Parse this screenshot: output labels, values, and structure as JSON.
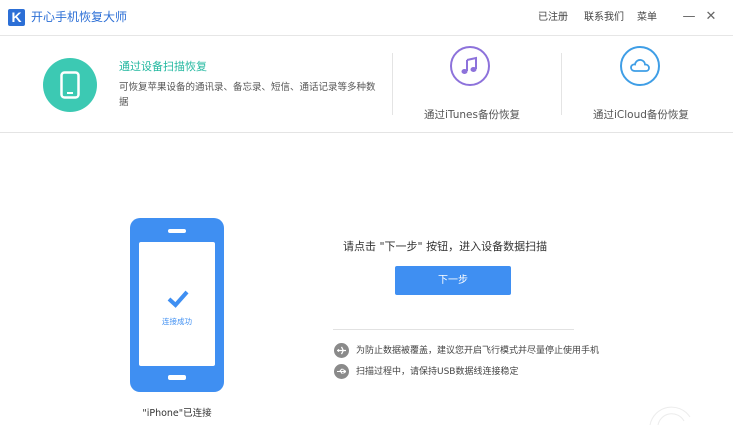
{
  "app": {
    "logo_letter": "K",
    "title": "开心手机恢复大师"
  },
  "titlebar": {
    "registered": "已注册",
    "contact": "联系我们",
    "menu": "菜单",
    "minimize": "—",
    "close": "✕"
  },
  "modes": [
    {
      "title": "通过设备扫描恢复",
      "description": "可恢复苹果设备的通讯录、备忘录、短信、通话记录等多种数据",
      "icon": "phone-icon",
      "color": "#3cc9b3",
      "active": true
    },
    {
      "title": "通过iTunes备份恢复",
      "icon": "music-note-icon",
      "color": "#8d72db"
    },
    {
      "title": "通过iCloud备份恢复",
      "icon": "cloud-icon",
      "color": "#3f9ee6"
    }
  ],
  "device": {
    "status": "连接成功",
    "label": "\"iPhone\"已连接"
  },
  "main": {
    "prompt": "请点击 \"下一步\" 按钮，进入设备数据扫描",
    "next_button": "下一步",
    "accent": "#3f8ff2"
  },
  "tips": [
    {
      "icon": "airplane-icon",
      "text": "为防止数据被覆盖，建议您开启飞行模式并尽量停止使用手机"
    },
    {
      "icon": "usb-icon",
      "text": "扫描过程中，请保持USB数据线连接稳定"
    }
  ]
}
